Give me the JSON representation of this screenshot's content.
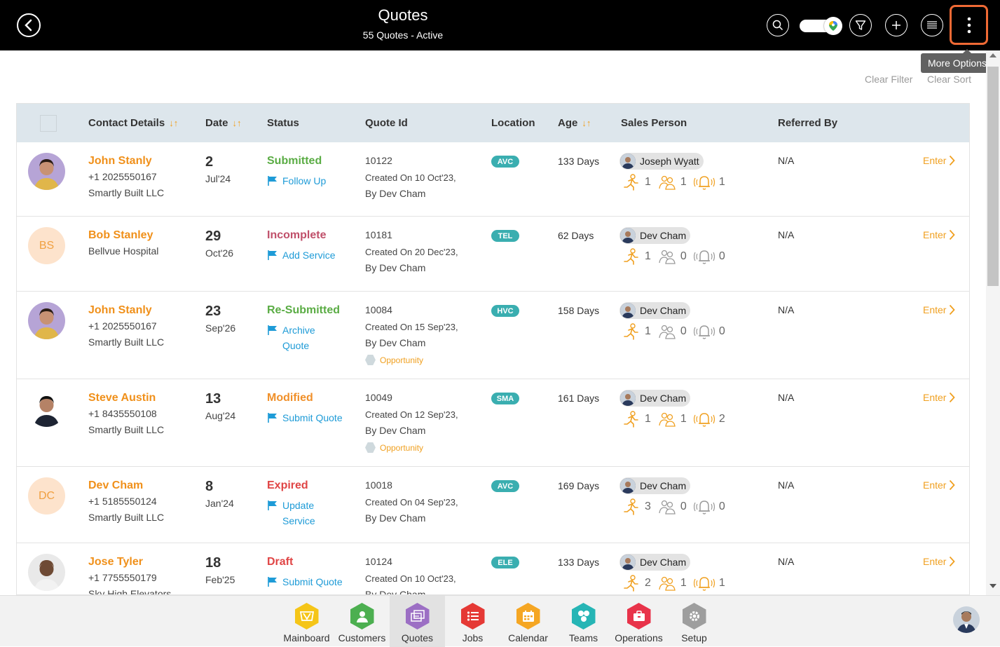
{
  "header": {
    "title": "Quotes",
    "subtitle": "55 Quotes - Active",
    "tooltip": "More Options",
    "clear_filter": "Clear Filter",
    "clear_sort": "Clear Sort"
  },
  "columns": {
    "contact": "Contact Details",
    "date": "Date",
    "status": "Status",
    "quote_id": "Quote Id",
    "location": "Location",
    "age": "Age",
    "sales_person": "Sales Person",
    "referred_by": "Referred By"
  },
  "rows": [
    {
      "name": "John Stanly",
      "line1": "+1 2025550167",
      "line2": "Smartly Built LLC",
      "day": "2",
      "month": "Jul'24",
      "status": "Submitted",
      "action": "Follow Up",
      "quote_id": "10122",
      "created": "Created On 10 Oct'23,",
      "by": "By Dev Cham",
      "opportunity": "",
      "location": "AVC",
      "age": "133 Days",
      "sales_person": "Joseph Wyatt",
      "s1": "1",
      "s2": "1",
      "s3": "1",
      "referred": "N/A",
      "enter": "Enter"
    },
    {
      "name": "Bob Stanley",
      "line1": "Bellvue Hospital",
      "line2": "",
      "initials": "BS",
      "day": "29",
      "month": "Oct'26",
      "status": "Incomplete",
      "action": "Add Service",
      "quote_id": "10181",
      "created": "Created On 20 Dec'23,",
      "by": "By Dev Cham",
      "opportunity": "",
      "location": "TEL",
      "age": "62 Days",
      "sales_person": "Dev Cham",
      "s1": "1",
      "s2": "0",
      "s3": "0",
      "referred": "N/A",
      "enter": "Enter"
    },
    {
      "name": "John Stanly",
      "line1": "+1 2025550167",
      "line2": "Smartly Built LLC",
      "day": "23",
      "month": "Sep'26",
      "status": "Re-Submitted",
      "action": "Archive Quote",
      "quote_id": "10084",
      "created": "Created On 15 Sep'23,",
      "by": "By Dev Cham",
      "opportunity": "Opportunity",
      "location": "HVC",
      "age": "158 Days",
      "sales_person": "Dev Cham",
      "s1": "1",
      "s2": "0",
      "s3": "0",
      "referred": "N/A",
      "enter": "Enter"
    },
    {
      "name": "Steve Austin",
      "line1": "+1 8435550108",
      "line2": "Smartly Built LLC",
      "day": "13",
      "month": "Aug'24",
      "status": "Modified",
      "action": "Submit Quote",
      "quote_id": "10049",
      "created": "Created On 12 Sep'23,",
      "by": "By Dev Cham",
      "opportunity": "Opportunity",
      "location": "SMA",
      "age": "161 Days",
      "sales_person": "Dev Cham",
      "s1": "1",
      "s2": "1",
      "s3": "2",
      "referred": "N/A",
      "enter": "Enter"
    },
    {
      "name": "Dev Cham",
      "line1": "+1 5185550124",
      "line2": "Smartly Built LLC",
      "initials": "DC",
      "day": "8",
      "month": "Jan'24",
      "status": "Expired",
      "action": "Update Service",
      "quote_id": "10018",
      "created": "Created On 04 Sep'23,",
      "by": "By Dev Cham",
      "opportunity": "",
      "location": "AVC",
      "age": "169 Days",
      "sales_person": "Dev Cham",
      "s1": "3",
      "s2": "0",
      "s3": "0",
      "referred": "N/A",
      "enter": "Enter"
    },
    {
      "name": "Jose Tyler",
      "line1": "+1 7755550179",
      "line2": "Sky High Elevators",
      "day": "18",
      "month": "Feb'25",
      "status": "Draft",
      "action": "Submit Quote",
      "quote_id": "10124",
      "created": "Created On 10 Oct'23,",
      "by": "By Dev Cham",
      "opportunity": "",
      "location": "ELE",
      "age": "133 Days",
      "sales_person": "Dev Cham",
      "s1": "2",
      "s2": "1",
      "s3": "1",
      "referred": "N/A",
      "enter": "Enter"
    }
  ],
  "status_colors": {
    "Submitted": "#5aac44",
    "Incomplete": "#c0506a",
    "Re-Submitted": "#5aac44",
    "Modified": "#f0902a",
    "Expired": "#e04545",
    "Draft": "#e04545"
  },
  "nav": [
    {
      "label": "Mainboard",
      "icon": "mainboard-icon",
      "color": "#f5c518"
    },
    {
      "label": "Customers",
      "icon": "customers-icon",
      "color": "#4caf50"
    },
    {
      "label": "Quotes",
      "icon": "quotes-icon",
      "color": "#9c6fc4"
    },
    {
      "label": "Jobs",
      "icon": "jobs-icon",
      "color": "#e53935"
    },
    {
      "label": "Calendar",
      "icon": "calendar-icon",
      "color": "#f5a623"
    },
    {
      "label": "Teams",
      "icon": "teams-icon",
      "color": "#26b5b5"
    },
    {
      "label": "Operations",
      "icon": "operations-icon",
      "color": "#e8334a"
    },
    {
      "label": "Setup",
      "icon": "setup-icon",
      "color": "#9e9e9e"
    }
  ]
}
